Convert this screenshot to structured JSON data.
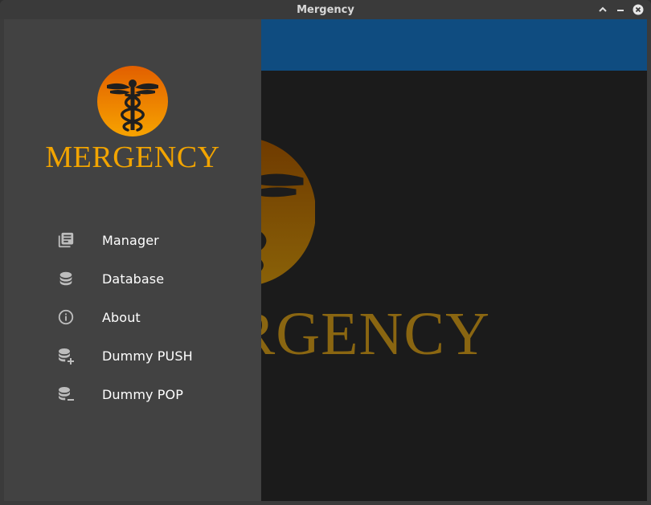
{
  "window": {
    "title": "Mergency",
    "controls": [
      {
        "name": "minimize-chevron-up-icon"
      },
      {
        "name": "minimize-icon"
      },
      {
        "name": "close-icon"
      }
    ]
  },
  "colors": {
    "appbar": "#0f4c80",
    "drawer": "#424242",
    "background": "#1b1b1b",
    "brand_orange": "#f2a400",
    "brand_dim": "#8a6611"
  },
  "background": {
    "wordmark_visible": "RGENCY"
  },
  "drawer": {
    "brand": "MERGENCY",
    "items": [
      {
        "label": "Manager",
        "icon": "library-books-icon"
      },
      {
        "label": "Database",
        "icon": "database-icon"
      },
      {
        "label": "About",
        "icon": "info-icon"
      },
      {
        "label": "Dummy PUSH",
        "icon": "database-plus-icon"
      },
      {
        "label": "Dummy POP",
        "icon": "database-minus-icon"
      }
    ]
  }
}
